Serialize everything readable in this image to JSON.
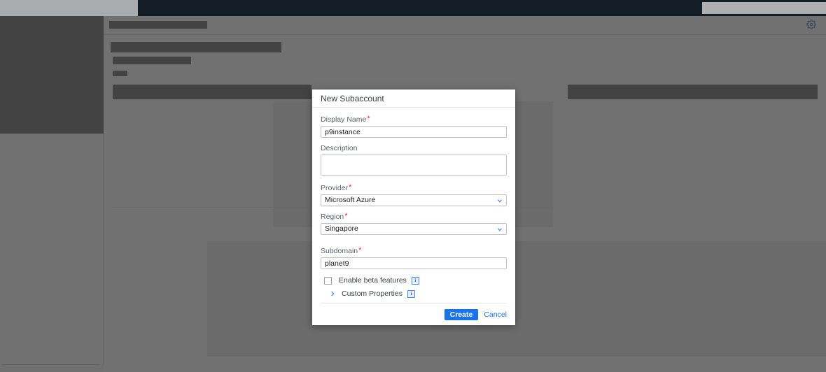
{
  "background": {
    "gear_icon": "gear-icon",
    "redacted": true
  },
  "dialog": {
    "title": "New Subaccount",
    "fields": {
      "display_name": {
        "label": "Display Name",
        "required_marker": "*",
        "value": "p9instance",
        "placeholder": ""
      },
      "description": {
        "label": "Description",
        "value": "",
        "placeholder": ""
      },
      "provider": {
        "label": "Provider",
        "required_marker": "*",
        "value": "Microsoft Azure",
        "chevron": "chevron-down-icon"
      },
      "region": {
        "label": "Region",
        "required_marker": "*",
        "value": "Singapore",
        "chevron": "chevron-down-icon"
      },
      "subdomain": {
        "label": "Subdomain",
        "required_marker": "*",
        "value": "planet9",
        "placeholder": ""
      }
    },
    "beta": {
      "label": "Enable beta features",
      "checked": false,
      "info_glyph": "i"
    },
    "custom_properties": {
      "label": "Custom Properties",
      "expanded": false,
      "info_glyph": "i",
      "chevron": "chevron-right-icon"
    },
    "footer": {
      "create_label": "Create",
      "cancel_label": "Cancel"
    }
  },
  "colors": {
    "accent_blue": "#1a73e8",
    "chevron_blue": "#4285f4",
    "required_red": "#d93025",
    "topbar_dark": "#141d26",
    "overlay_gray": "#717171"
  }
}
